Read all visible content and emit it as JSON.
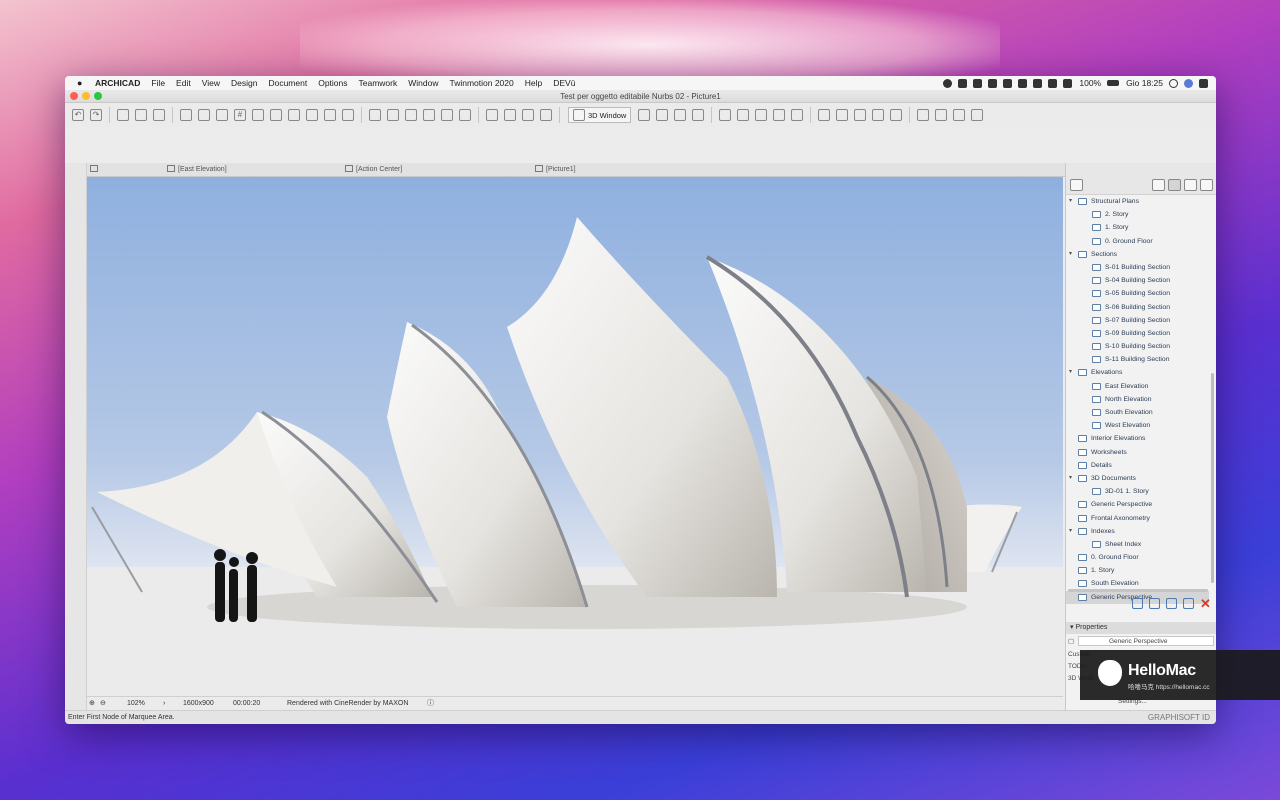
{
  "menubar": {
    "app_name": "ARCHICAD",
    "items": [
      "File",
      "Edit",
      "View",
      "Design",
      "Document",
      "Options",
      "Teamwork",
      "Window",
      "Twinmotion 2020",
      "Help",
      "DEVū"
    ],
    "battery": "100%",
    "clock": "Gio 18:25"
  },
  "window": {
    "title": "Test per oggetto editabile Nurbs 02 - Picture1"
  },
  "toolbar": {
    "view_3d_label": "3D Window"
  },
  "tabs": [
    {
      "label": "[East Elevation]"
    },
    {
      "label": "[Action Center]"
    },
    {
      "label": "[Picture1]"
    }
  ],
  "statusbar": {
    "zoom": "102%",
    "resolution": "1600x900",
    "time": "00:00:20",
    "render_info": "Rendered with CineRender by MAXON",
    "hint": "Enter First Node of Marquee Area."
  },
  "navigator": {
    "tree": [
      {
        "label": "Structural Plans",
        "level": 0,
        "expanded": true
      },
      {
        "label": "2. Story",
        "level": 1
      },
      {
        "label": "1. Story",
        "level": 1
      },
      {
        "label": "0. Ground Floor",
        "level": 1
      },
      {
        "label": "Sections",
        "level": 0,
        "expanded": true
      },
      {
        "label": "S-01 Building Section",
        "level": 1
      },
      {
        "label": "S-04 Building Section",
        "level": 1
      },
      {
        "label": "S-05 Building Section",
        "level": 1
      },
      {
        "label": "S-06 Building Section",
        "level": 1
      },
      {
        "label": "S-07 Building Section",
        "level": 1
      },
      {
        "label": "S-09 Building Section",
        "level": 1
      },
      {
        "label": "S-10 Building Section",
        "level": 1
      },
      {
        "label": "S-11 Building Section",
        "level": 1
      },
      {
        "label": "Elevations",
        "level": 0,
        "expanded": true
      },
      {
        "label": "East Elevation",
        "level": 1
      },
      {
        "label": "North Elevation",
        "level": 1
      },
      {
        "label": "South Elevation",
        "level": 1
      },
      {
        "label": "West Elevation",
        "level": 1
      },
      {
        "label": "Interior Elevations",
        "level": 0
      },
      {
        "label": "Worksheets",
        "level": 0
      },
      {
        "label": "Details",
        "level": 0
      },
      {
        "label": "3D Documents",
        "level": 0,
        "expanded": true
      },
      {
        "label": "3D-01 1. Story",
        "level": 1
      },
      {
        "label": "Generic Perspective",
        "level": 0
      },
      {
        "label": "Frontal Axonometry",
        "level": 0
      },
      {
        "label": "Indexes",
        "level": 0,
        "expanded": true
      },
      {
        "label": "Sheet Index",
        "level": 1
      },
      {
        "label": "0. Ground Floor",
        "level": 0
      },
      {
        "label": "1. Story",
        "level": 0
      },
      {
        "label": "South Elevation",
        "level": 0
      },
      {
        "label": "Generic Perspective",
        "level": 0,
        "selected": true
      }
    ],
    "properties_title": "Properties",
    "properties_name": "Generic Perspective",
    "properties_rows": [
      "Custom",
      "TODO",
      "3D Wind"
    ],
    "settings_label": "Settings..."
  },
  "brand": {
    "vendor": "GRAPHISOFT ID",
    "watermark_title": "HelloMac",
    "watermark_sub": "哈喽马克 https://hellomac.cc"
  },
  "colors": {
    "sky_top": "#8fb0df",
    "sky_bottom": "#e4e8f2",
    "ground": "#ecebeb",
    "close_red": "#ff5f57",
    "minimize_yellow": "#febc2e",
    "zoom_green": "#28c840"
  }
}
